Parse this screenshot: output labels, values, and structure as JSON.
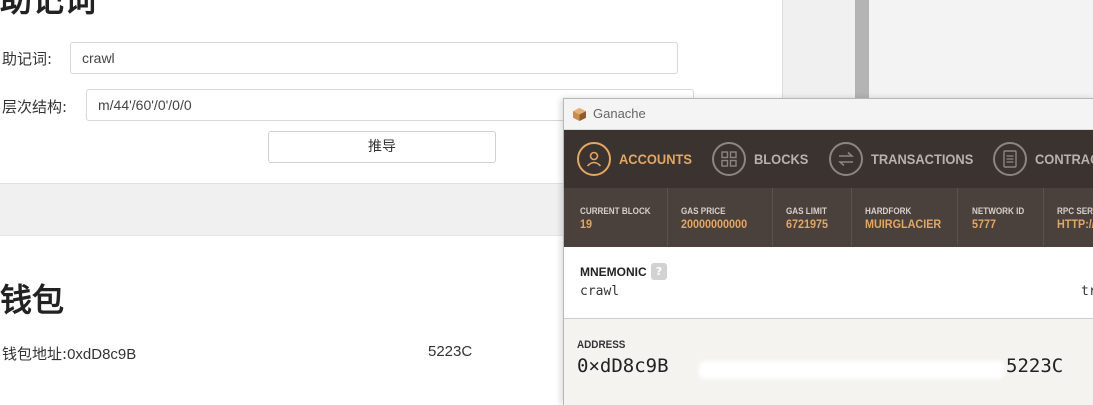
{
  "web": {
    "mnemonic_heading": "助记词",
    "mnemonic_label": "助记词:",
    "mnemonic_value": "crawl",
    "path_label": "层次结构:",
    "path_value": "m/44'/60'/0'/0/0",
    "derive_button": "推导",
    "wallet_heading": "钱包",
    "wallet_address_label": "钱包地址:",
    "wallet_address_head": "0xdD8c9B",
    "wallet_address_tail": "5223C"
  },
  "ganache": {
    "title": "Ganache",
    "nav": [
      {
        "label": "ACCOUNTS",
        "icon": "user-icon",
        "active": true
      },
      {
        "label": "BLOCKS",
        "icon": "blocks-icon",
        "active": false
      },
      {
        "label": "TRANSACTIONS",
        "icon": "transactions-icon",
        "active": false
      },
      {
        "label": "CONTRACTS",
        "icon": "contracts-icon",
        "active": false
      }
    ],
    "status": [
      {
        "label": "CURRENT BLOCK",
        "value": "19"
      },
      {
        "label": "GAS PRICE",
        "value": "20000000000"
      },
      {
        "label": "GAS LIMIT",
        "value": "6721975"
      },
      {
        "label": "HARDFORK",
        "value": "MUIRGLACIER"
      },
      {
        "label": "NETWORK ID",
        "value": "5777"
      },
      {
        "label": "RPC SERVER",
        "value": "HTTP://"
      }
    ],
    "mnemonic_label": "MNEMONIC",
    "mnemonic_help": "?",
    "mnemonic_value": "crawl",
    "mnemonic_tail": "tr",
    "address_label": "ADDRESS",
    "address_head": "0×dD8c9B",
    "address_tail": "5223C"
  },
  "colors": {
    "accent": "#e4a663",
    "nav_bg": "#3a3330",
    "status_bg": "#4a413c"
  }
}
